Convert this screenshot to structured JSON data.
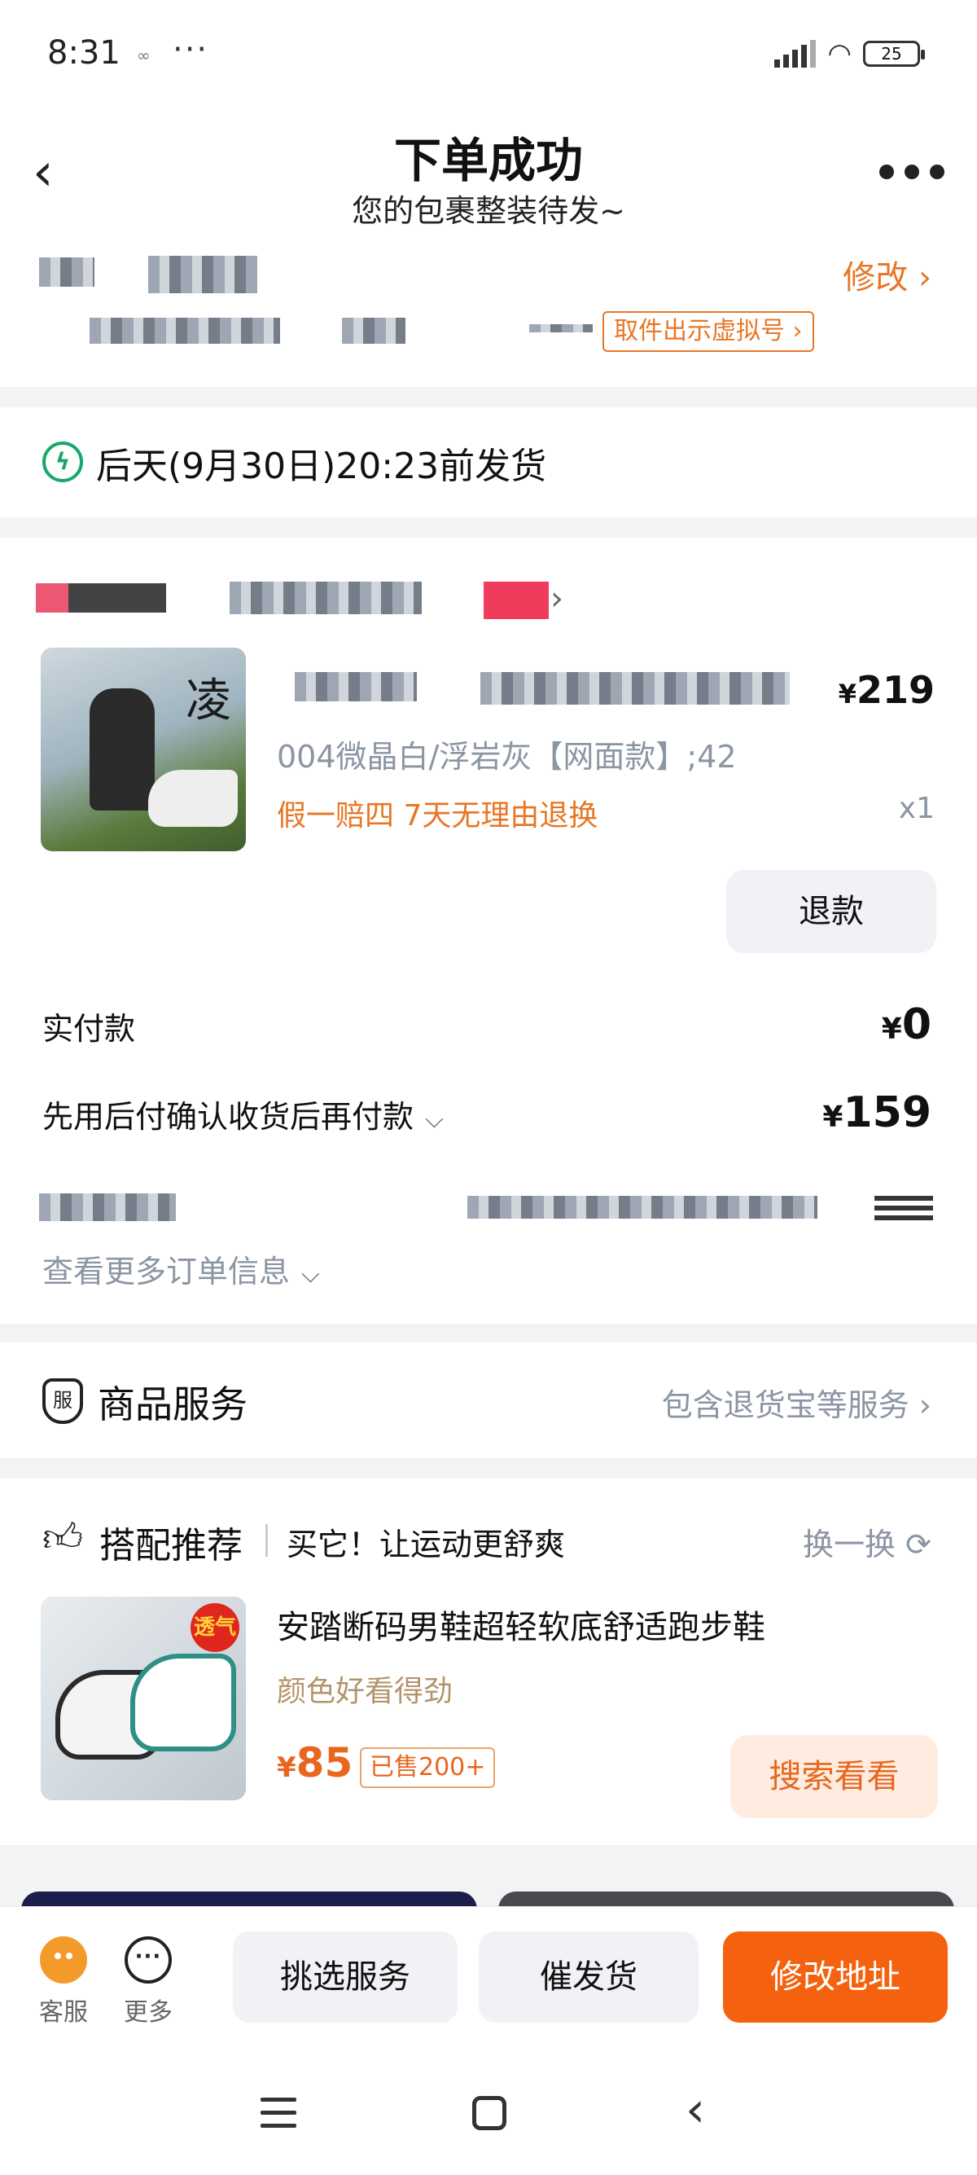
{
  "status": {
    "time": "8:31",
    "battery": "25"
  },
  "header": {
    "title": "下单成功",
    "subtitle": "您的包裹整装待发~"
  },
  "address": {
    "modify_label": "修改",
    "virtual_number_tag": "取件出示虚拟号"
  },
  "delivery": {
    "text": "后天(9月30日)20:23前发货",
    "icon": "lightning-icon",
    "icon_color": "#17a86b"
  },
  "order": {
    "price_symbol": "¥",
    "price": "219",
    "sku": "004微晶白/浮岩灰【网面款】;42",
    "guarantee": "假一赔四  7天无理由退换",
    "quantity": "x1",
    "refund_label": "退款",
    "paid_label": "实付款",
    "paid_value": "0",
    "later_label": "先用后付确认收货后再付款",
    "later_value": "159",
    "more_info_label": "查看更多订单信息"
  },
  "service": {
    "title": "商品服务",
    "icon_text": "服",
    "detail": "包含退货宝等服务"
  },
  "recommend": {
    "title": "搭配推荐",
    "slogan": "买它！让运动更舒爽",
    "swap_label": "换一换",
    "badge": "透气",
    "product_name": "安踏断码男鞋超轻软底舒适跑步鞋",
    "product_desc": "颜色好看得劲",
    "price_symbol": "¥",
    "price": "85",
    "sold": "已售200+",
    "search_label": "搜索看看"
  },
  "actions": {
    "customer_service": "客服",
    "more": "更多",
    "pick_service": "挑选服务",
    "urge_shipping": "催发货",
    "modify_address": "修改地址"
  },
  "colors": {
    "accent": "#f5620f",
    "link_orange": "#e87624",
    "muted": "#8b95a3"
  }
}
